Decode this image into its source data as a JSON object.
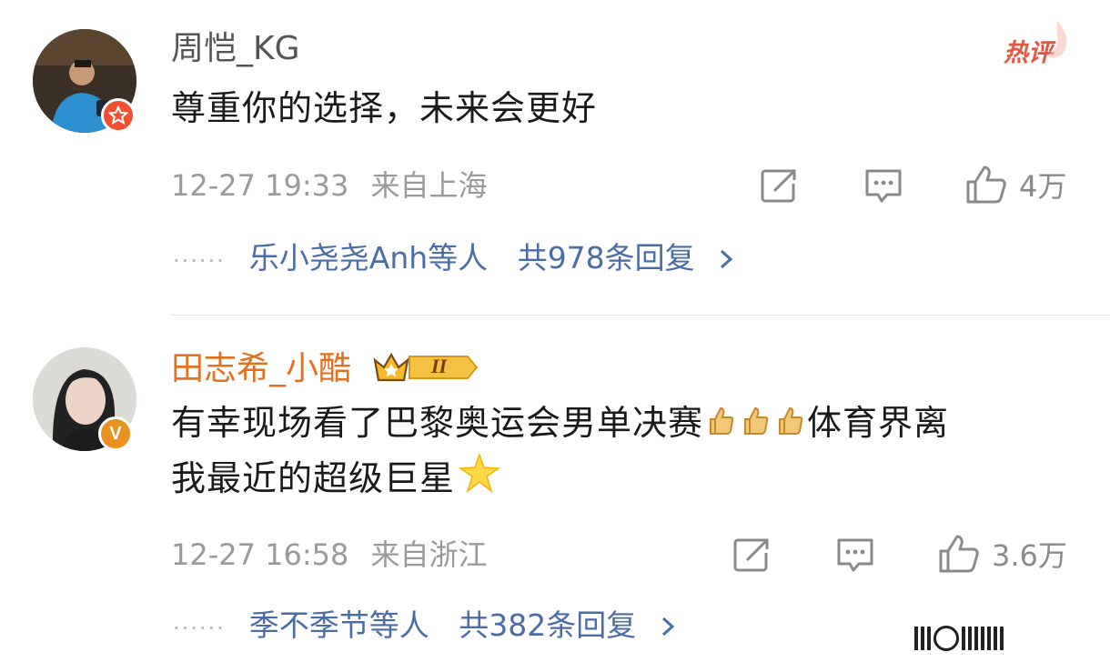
{
  "comments": [
    {
      "username": "周恺_KG",
      "username_color": "#555555",
      "hot_label": "热评",
      "text": "尊重你的选择，未来会更好",
      "time": "12-27 19:33",
      "location": "来自上海",
      "likes": "4万",
      "replies_prefix": "乐小尧尧Anh等人",
      "replies_count": "共978条回复",
      "avatar_icon": "player-photo",
      "badge_icon": "star-badge-icon"
    },
    {
      "username": "田志希_小酷",
      "username_color": "#e4701d",
      "level_badge": "II",
      "text_line1": "有幸现场看了巴黎奥运会男单决赛",
      "text_line1_end": "体育界离",
      "text_line2": "我最近的超级巨星",
      "time": "12-27 16:58",
      "location": "来自浙江",
      "likes": "3.6万",
      "replies_prefix": "季不季节等人",
      "replies_count": "共382条回复",
      "avatar_icon": "woman-photo",
      "badge_icon": "verified-v-icon"
    }
  ],
  "icons": {
    "repost": "share-icon",
    "comment": "comment-icon",
    "like": "thumbs-up-icon",
    "chevron": "chevron-right-icon"
  },
  "colors": {
    "link": "#4a6da7",
    "meta": "#9a9a9a",
    "hot": "#e8543f",
    "vip_name": "#e4701d"
  }
}
